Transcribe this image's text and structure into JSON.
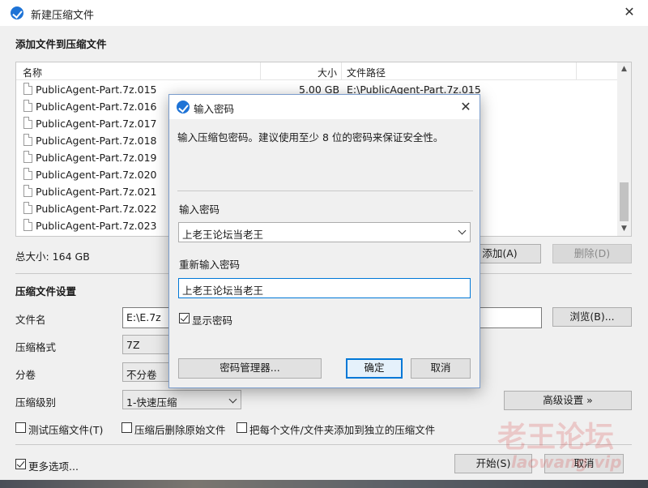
{
  "window": {
    "title": "新建压缩文件",
    "close_glyph": "✕"
  },
  "add_files": {
    "section_title": "添加文件到压缩文件",
    "columns": [
      "名称",
      "大小",
      "文件路径"
    ],
    "rows": [
      {
        "name": "PublicAgent-Part.7z.015",
        "size": "5.00 GB",
        "path": "E:\\PublicAgent-Part.7z.015"
      },
      {
        "name": "PublicAgent-Part.7z.016",
        "size": "",
        "path": ""
      },
      {
        "name": "PublicAgent-Part.7z.017",
        "size": "",
        "path": ""
      },
      {
        "name": "PublicAgent-Part.7z.018",
        "size": "",
        "path": ""
      },
      {
        "name": "PublicAgent-Part.7z.019",
        "size": "",
        "path": ""
      },
      {
        "name": "PublicAgent-Part.7z.020",
        "size": "",
        "path": ""
      },
      {
        "name": "PublicAgent-Part.7z.021",
        "size": "",
        "path": ""
      },
      {
        "name": "PublicAgent-Part.7z.022",
        "size": "",
        "path": ""
      },
      {
        "name": "PublicAgent-Part.7z.023",
        "size": "",
        "path": ""
      }
    ],
    "total_size_label": "总大小: 164 GB",
    "add_button": "添加(A)",
    "remove_button": "删除(D)"
  },
  "settings": {
    "section_title": "压缩文件设置",
    "filename_label": "文件名",
    "filename_value": "E:\\E.7z",
    "browse_button": "浏览(B)...",
    "format_label": "压缩格式",
    "format_value": "7Z",
    "split_label": "分卷",
    "split_value": "不分卷",
    "level_label": "压缩级别",
    "level_value": "1-快速压缩",
    "advanced_button": "高级设置 »",
    "options": [
      {
        "label": "测试压缩文件(T)",
        "checked": false
      },
      {
        "label": "压缩后删除原始文件",
        "checked": false
      },
      {
        "label": "把每个文件/文件夹添加到独立的压缩文件",
        "checked": false
      }
    ],
    "more_options": {
      "label": "更多选项...",
      "checked": true
    },
    "start_button": "开始(S)",
    "cancel_button": "取消"
  },
  "password_dialog": {
    "title": "输入密码",
    "close_glyph": "✕",
    "description": "输入压缩包密码。建议使用至少 8 位的密码来保证安全性。",
    "password_label": "输入密码",
    "password_value": "上老王论坛当老王",
    "confirm_label": "重新输入密码",
    "confirm_value": "上老王论坛当老王",
    "show_password": {
      "label": "显示密码",
      "checked": true
    },
    "manager_button": "密码管理器...",
    "ok_button": "确定",
    "cancel_button": "取消"
  },
  "watermark": {
    "text": "老王论坛",
    "url": "laowang.vip"
  },
  "colors": {
    "accent": "#0078d7",
    "app_icon": "#1e73d6"
  }
}
